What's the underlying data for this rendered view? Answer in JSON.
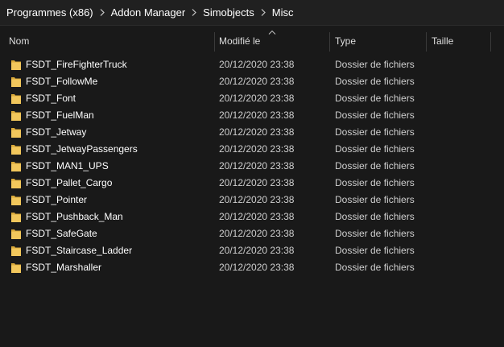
{
  "breadcrumb": {
    "items": [
      "Programmes (x86)",
      "Addon Manager",
      "Simobjects",
      "Misc"
    ]
  },
  "columns": {
    "name": "Nom",
    "modified": "Modifié le",
    "type": "Type",
    "size": "Taille"
  },
  "sort": {
    "column": "modified",
    "direction": "ascending"
  },
  "files": [
    {
      "name": "FSDT_FireFighterTruck",
      "modified": "20/12/2020 23:38",
      "type": "Dossier de fichiers",
      "size": ""
    },
    {
      "name": "FSDT_FollowMe",
      "modified": "20/12/2020 23:38",
      "type": "Dossier de fichiers",
      "size": ""
    },
    {
      "name": "FSDT_Font",
      "modified": "20/12/2020 23:38",
      "type": "Dossier de fichiers",
      "size": ""
    },
    {
      "name": "FSDT_FuelMan",
      "modified": "20/12/2020 23:38",
      "type": "Dossier de fichiers",
      "size": ""
    },
    {
      "name": "FSDT_Jetway",
      "modified": "20/12/2020 23:38",
      "type": "Dossier de fichiers",
      "size": ""
    },
    {
      "name": "FSDT_JetwayPassengers",
      "modified": "20/12/2020 23:38",
      "type": "Dossier de fichiers",
      "size": ""
    },
    {
      "name": "FSDT_MAN1_UPS",
      "modified": "20/12/2020 23:38",
      "type": "Dossier de fichiers",
      "size": ""
    },
    {
      "name": "FSDT_Pallet_Cargo",
      "modified": "20/12/2020 23:38",
      "type": "Dossier de fichiers",
      "size": ""
    },
    {
      "name": "FSDT_Pointer",
      "modified": "20/12/2020 23:38",
      "type": "Dossier de fichiers",
      "size": ""
    },
    {
      "name": "FSDT_Pushback_Man",
      "modified": "20/12/2020 23:38",
      "type": "Dossier de fichiers",
      "size": ""
    },
    {
      "name": "FSDT_SafeGate",
      "modified": "20/12/2020 23:38",
      "type": "Dossier de fichiers",
      "size": ""
    },
    {
      "name": "FSDT_Staircase_Ladder",
      "modified": "20/12/2020 23:38",
      "type": "Dossier de fichiers",
      "size": ""
    },
    {
      "name": "FSDT_Marshaller",
      "modified": "20/12/2020 23:38",
      "type": "Dossier de fichiers",
      "size": ""
    }
  ],
  "icons": {
    "folder": "folder-icon",
    "breadcrumb_separator": "chevron-right-icon",
    "sort_indicator": "sort-up-icon"
  },
  "colors": {
    "background": "#191919",
    "breadcrumb_bar": "#202020",
    "text": "#ffffff",
    "secondary_text": "#cfcfcf",
    "folder": "#f2c75c",
    "divider": "#3a3a3a"
  }
}
